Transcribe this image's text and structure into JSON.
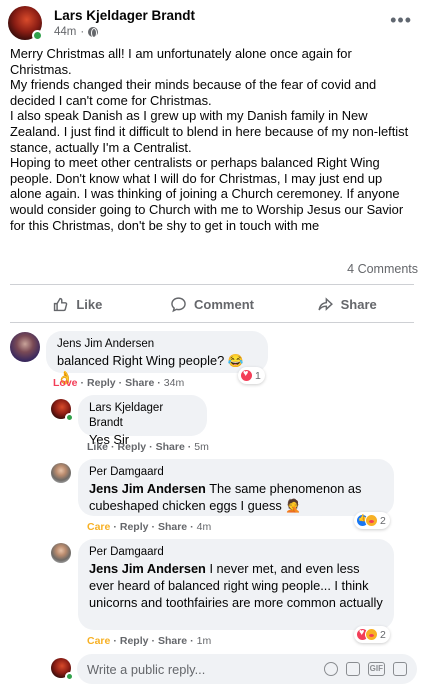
{
  "post": {
    "author": "Lars Kjeldager Brandt",
    "time": "44m",
    "paragraphs": [
      "Merry Christmas all! I am unfortunately alone once again for Christmas.",
      "My friends changed their minds because of the fear of covid and decided I can't come for Christmas.",
      "I also speak Danish as I grew up with my Danish family in New Zealand. I just find it difficult to blend in here because of my non-leftist stance, actually I'm a Centralist.",
      "Hoping to meet other centralists or perhaps balanced Right Wing people. Don't know what I will do for Christmas, I may just end up alone again. I was thinking of joining a Church ceremoney. If anyone would consider going to Church with me to Worship Jesus our Savior for this Christmas, don't be shy to get in touch with me"
    ],
    "comments_count": "4 Comments",
    "actions": {
      "like": "Like",
      "comment": "Comment",
      "share": "Share"
    }
  },
  "comments": [
    {
      "author": "Jens Jim Andersen",
      "text": "balanced Right Wing people? 😂👌",
      "action_reaction": "Love",
      "reply": "Reply",
      "share": "Share",
      "time": "34m",
      "reaction_count": "1"
    },
    {
      "author": "Lars Kjeldager Brandt",
      "text": "Yes Sir",
      "action_reaction": "Like",
      "reply": "Reply",
      "share": "Share",
      "time": "5m"
    },
    {
      "author": "Per Damgaard",
      "mention": "Jens Jim Andersen",
      "text": " The same phenomenon as cubeshaped chicken eggs I guess 🤦",
      "action_reaction": "Care",
      "reply": "Reply",
      "share": "Share",
      "time": "4m",
      "reaction_count": "2"
    },
    {
      "author": "Per Damgaard",
      "mention": "Jens Jim Andersen",
      "text": " I never met, and even less ever heard of balanced right wing people... I think unicorns and toothfairies are more common actually",
      "action_reaction": "Care",
      "reply": "Reply",
      "share": "Share",
      "time": "1m",
      "reaction_count": "2"
    }
  ],
  "reply_box": {
    "placeholder": "Write a public reply..."
  },
  "colors": {
    "love": "#f33e58",
    "care": "#f7b125",
    "secondary_text": "#65676b",
    "bubble": "#f0f2f5"
  },
  "icons": {
    "more": "more-dots-icon",
    "like": "thumbs-up-icon",
    "comment": "speech-bubble-icon",
    "share": "share-arrow-icon",
    "emoji": "emoji-icon",
    "camera": "camera-icon",
    "gif": "gif-icon",
    "sticker": "sticker-icon"
  }
}
